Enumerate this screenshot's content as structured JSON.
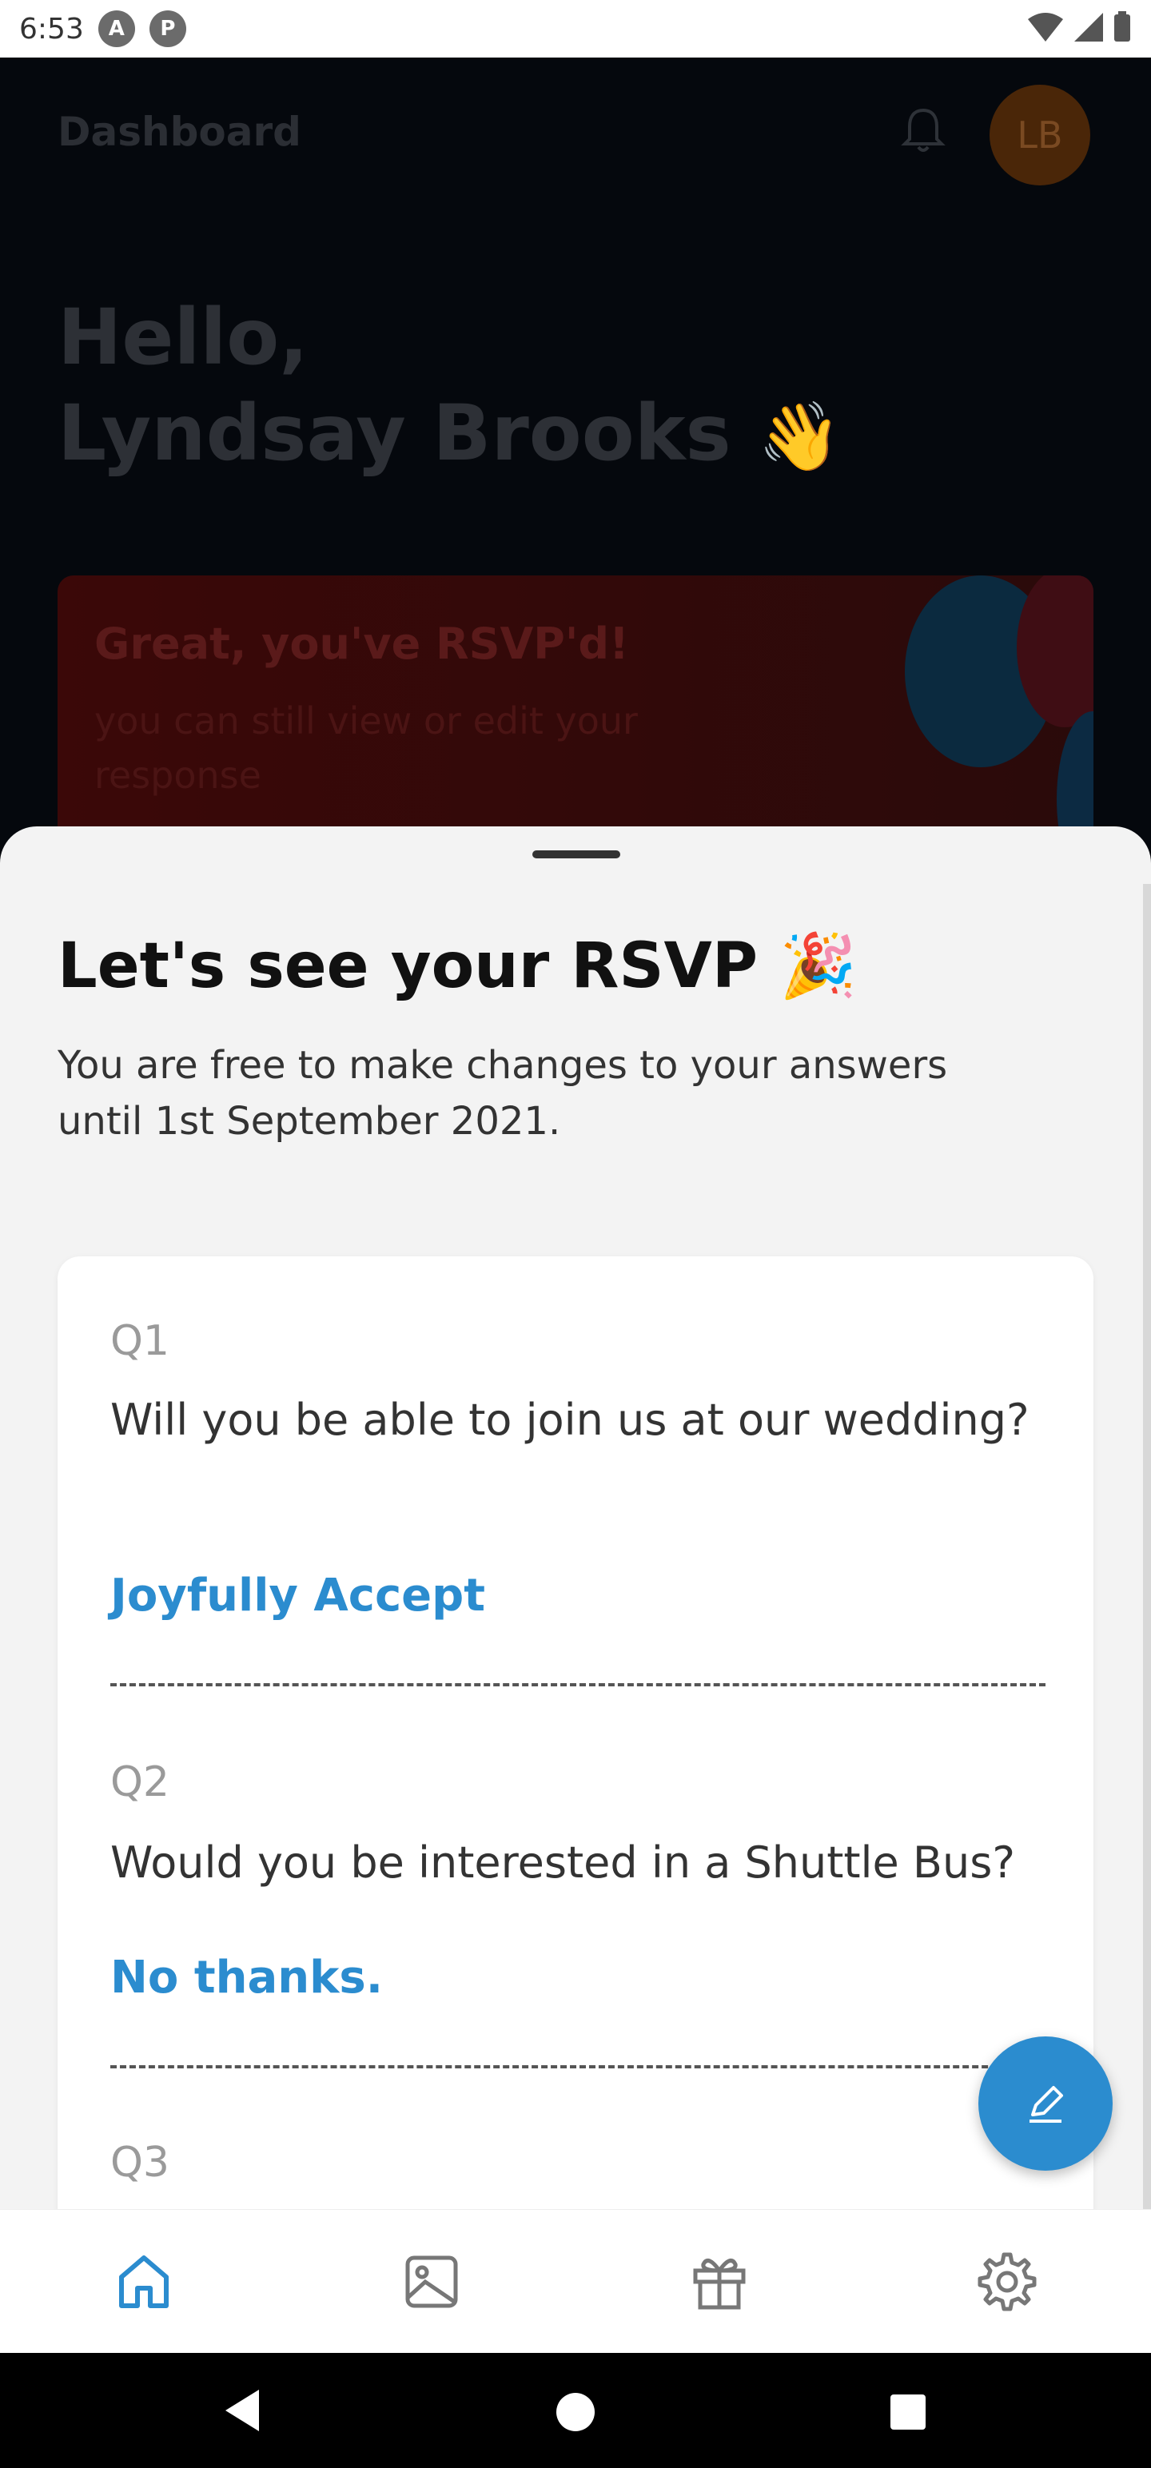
{
  "status_bar": {
    "time": "6:53",
    "icon1": "A",
    "icon2": "P"
  },
  "dashboard": {
    "title": "Dashboard",
    "avatar_initials": "LB",
    "greeting_line1": "Hello,",
    "greeting_line2": "Lyndsay Brooks",
    "greeting_emoji": "👋",
    "banner_title": "Great, you've RSVP'd!",
    "banner_subtitle": "you can still view or edit your response"
  },
  "sheet": {
    "title": "Let's see your RSVP 🎉",
    "subtitle": "You are free to make changes to your answers until 1st September 2021.",
    "questions": [
      {
        "num": "Q1",
        "text": "Will you be able to join us at our wedding?",
        "answer": "Joyfully Accept"
      },
      {
        "num": "Q2",
        "text": "Would you be interested in a Shuttle Bus?",
        "answer": "No thanks."
      },
      {
        "num": "Q3",
        "text": "",
        "answer": ""
      }
    ]
  },
  "colors": {
    "accent": "#2b8ccf",
    "sheet_bg": "#f3f3f3"
  },
  "nav": [
    "home-icon",
    "gallery-icon",
    "gift-icon",
    "settings-icon"
  ]
}
